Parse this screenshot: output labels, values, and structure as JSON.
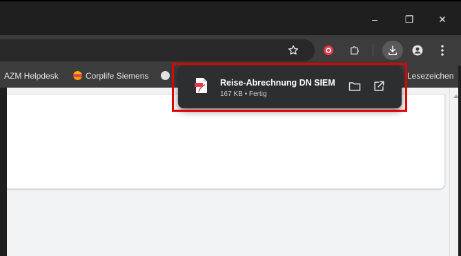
{
  "window_controls": {
    "minimize": "–",
    "restore": "❐",
    "close": "✕"
  },
  "toolbar": {
    "icons": [
      "star-icon",
      "extension-red-icon",
      "puzzle-icon",
      "download-icon",
      "profile-icon",
      "menu-icon"
    ]
  },
  "bookmarks": [
    {
      "label": "AZM Helpdesk"
    },
    {
      "label": "Corplife Siemens"
    },
    {
      "label": "Lesezeichen"
    }
  ],
  "download": {
    "file_name": "Reise-Abrechnung DN SIEM",
    "status": "167 KB • Fertig"
  },
  "colors": {
    "highlight": "#e00000",
    "titlebar": "#1f1f1f",
    "toolbar": "#3c3c3c",
    "bubble": "#2d2e30"
  }
}
